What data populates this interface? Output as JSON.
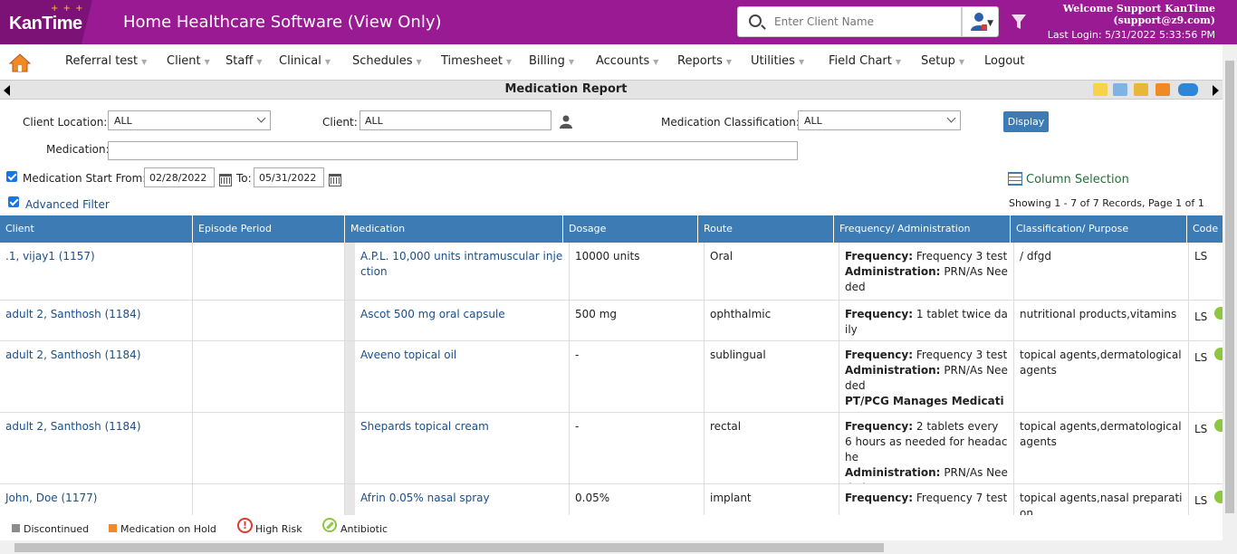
{
  "header": {
    "logo_text": "KanTime",
    "app_title": "Home Healthcare Software",
    "app_mode": "(View Only)",
    "search_placeholder": "Enter Client Name",
    "welcome": "Welcome Support KanTime",
    "email": "(support@z9.com)",
    "last_login": "Last Login: 5/31/2022 5:33:56 PM"
  },
  "nav": {
    "items": [
      "Referral test",
      "Client",
      "Staff",
      "Clinical",
      "Schedules",
      "Timesheet",
      "Billing",
      "Accounts",
      "Reports",
      "Utilities",
      "Field Chart",
      "Setup",
      "Logout"
    ]
  },
  "page": {
    "title": "Medication Report"
  },
  "filters": {
    "client_location_label": "Client Location:",
    "client_location_value": "ALL",
    "client_label": "Client:",
    "client_value": "ALL",
    "classification_label": "Medication Classification:",
    "classification_value": "ALL",
    "display_button": "Display",
    "medication_label": "Medication:",
    "medication_value": "",
    "start_from_label": "Medication Start From:",
    "start_from_value": "02/28/2022",
    "to_label": "To:",
    "to_value": "05/31/2022",
    "advanced_filter_label": "Advanced Filter",
    "column_selection_label": "Column Selection",
    "records_info": "Showing 1 - 7 of 7 Records, Page 1 of 1"
  },
  "table": {
    "columns": [
      "Client",
      "Episode Period",
      "Medication",
      "Dosage",
      "Route",
      "Frequency/ Administration",
      "Classification/ Purpose",
      "Code"
    ],
    "rows": [
      {
        "client": ".1, vijay1 (1157)",
        "episode": "",
        "medication": "A.P.L. 10,000 units intramuscular injection",
        "dosage": "10000 units",
        "route": "Oral",
        "frequency": "Frequency 3 test",
        "administration": "PRN/As Needed",
        "extra": "",
        "classification": "/ dfgd",
        "code": "LS",
        "antibiotic": false
      },
      {
        "client": "adult 2, Santhosh (1184)",
        "episode": "",
        "medication": "Ascot 500 mg oral capsule",
        "dosage": "500 mg",
        "route": "ophthalmic",
        "frequency": "1 tablet twice daily",
        "administration": "",
        "extra": "",
        "classification": "nutritional products,vitamins",
        "code": "LS",
        "antibiotic": true
      },
      {
        "client": "adult 2, Santhosh (1184)",
        "episode": "",
        "medication": "Aveeno topical oil",
        "dosage": "-",
        "route": "sublingual",
        "frequency": "Frequency 3 test",
        "administration": "PRN/As Needed",
        "extra": "PT/PCG Manages Medication",
        "classification": "topical agents,dermatological agents",
        "code": "LS",
        "antibiotic": true
      },
      {
        "client": "adult 2, Santhosh (1184)",
        "episode": "",
        "medication": "Shepards topical cream",
        "dosage": "-",
        "route": "rectal",
        "frequency": "2 tablets every 6 hours as needed for headache",
        "administration": "PRN/As Needed",
        "extra": "",
        "classification": "topical agents,dermatological agents",
        "code": "LS",
        "antibiotic": true
      },
      {
        "client": "John, Doe (1177)",
        "episode": "",
        "medication": "Afrin 0.05% nasal spray",
        "dosage": "0.05%",
        "route": "implant",
        "frequency": "Frequency 7 test",
        "administration": "",
        "extra": "",
        "classification": "topical agents,nasal preparation",
        "code": "LS",
        "antibiotic": true
      }
    ],
    "freq_label": "Frequency:",
    "admin_label": "Administration:"
  },
  "legend": {
    "discontinued": "Discontinued",
    "on_hold": "Medication on Hold",
    "high_risk": "High Risk",
    "antibiotic": "Antibiotic"
  },
  "colors": {
    "brand": "#9a1a93",
    "header_blue": "#3d7bb5",
    "discontinued": "#8c8c8c",
    "on_hold": "#f08a24",
    "high_risk": "#e03a2f",
    "antibiotic": "#8dc63f"
  }
}
